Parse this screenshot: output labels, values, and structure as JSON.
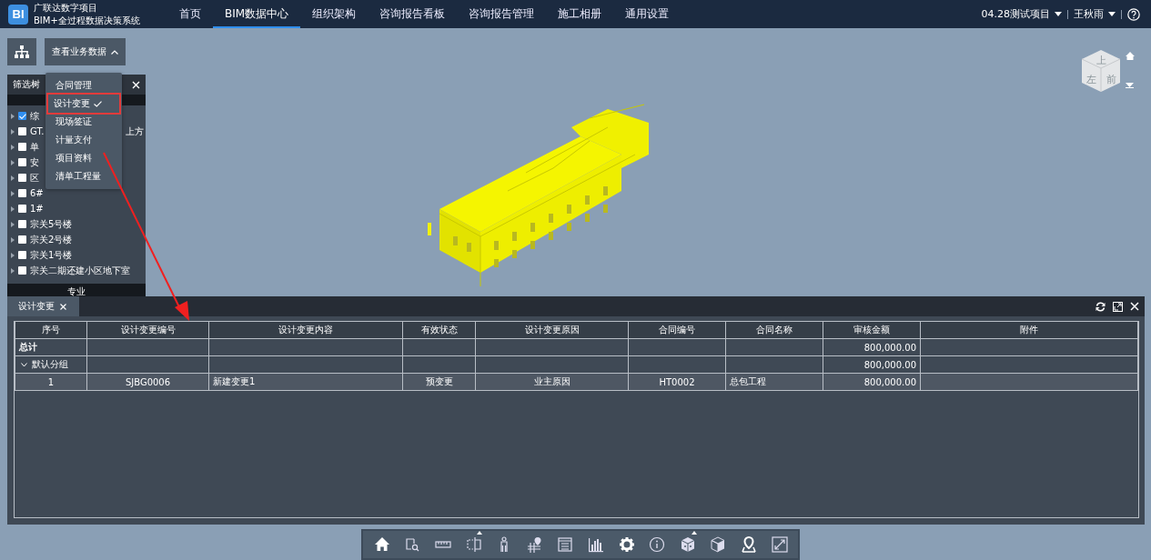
{
  "header": {
    "logo": "BI",
    "title": "广联达数字项目",
    "subtitle": "BIM+全过程数据决策系统",
    "nav": [
      {
        "label": "首页",
        "selected": false
      },
      {
        "label": "BIM数据中心",
        "selected": true
      },
      {
        "label": "组织架构",
        "selected": false
      },
      {
        "label": "咨询报告看板",
        "selected": false
      },
      {
        "label": "咨询报告管理",
        "selected": false
      },
      {
        "label": "施工相册",
        "selected": false
      },
      {
        "label": "通用设置",
        "selected": false
      }
    ],
    "project": "04.28测试项目",
    "user": "王秋雨"
  },
  "viewer": {
    "data_button": {
      "label": "查看业务数据",
      "expanded": true
    },
    "dropdown": [
      {
        "label": "合同管理",
        "selected": false
      },
      {
        "label": "设计变更",
        "selected": true
      },
      {
        "label": "现场签证",
        "selected": false
      },
      {
        "label": "计量支付",
        "selected": false
      },
      {
        "label": "项目资料",
        "selected": false
      },
      {
        "label": "清单工程量",
        "selected": false
      }
    ],
    "filter_panel": {
      "title": "筛选树",
      "section": "专业",
      "tree": [
        {
          "label": "综",
          "checked": true
        },
        {
          "label": "GT.",
          "tail": "上方",
          "checked": false
        },
        {
          "label": "单",
          "checked": false
        },
        {
          "label": "安",
          "checked": false
        },
        {
          "label": "区",
          "checked": false
        },
        {
          "label": "6#",
          "checked": false
        },
        {
          "label": "1#",
          "checked": false
        },
        {
          "label": "宗关5号楼",
          "checked": false
        },
        {
          "label": "宗关2号楼",
          "checked": false
        },
        {
          "label": "宗关1号楼",
          "checked": false
        },
        {
          "label": "宗关二期还建小区地下室",
          "checked": false
        }
      ]
    },
    "nav_cube": {
      "faces": [
        "上",
        "左",
        "前"
      ]
    },
    "panel": {
      "tabs": [
        {
          "label": "设计变更",
          "selected": true
        }
      ],
      "table": {
        "columns": [
          "序号",
          "设计变更编号",
          "设计变更内容",
          "有效状态",
          "设计变更原因",
          "合同编号",
          "合同名称",
          "审核金额",
          "附件"
        ],
        "rows": [
          {
            "kind": "total",
            "cells": [
              "总计",
              null,
              null,
              null,
              null,
              null,
              null,
              "800,000.00",
              null
            ]
          },
          {
            "kind": "group",
            "expanded": true,
            "cells": [
              "默认分组",
              null,
              null,
              null,
              null,
              null,
              null,
              "800,000.00",
              null
            ]
          },
          {
            "kind": "data",
            "cells": [
              "1",
              "SJBG0006",
              "新建变更1",
              "预变更",
              "业主原因",
              "HT0002",
              "总包工程",
              "800,000.00",
              null
            ]
          }
        ]
      }
    },
    "toolbar": [
      {
        "kind": "home",
        "has_menu": false
      },
      {
        "kind": "zoom-box",
        "has_menu": false
      },
      {
        "kind": "ruler",
        "has_menu": false
      },
      {
        "kind": "section",
        "has_menu": true
      },
      {
        "kind": "person",
        "has_menu": false
      },
      {
        "kind": "axis-pin",
        "has_menu": false
      },
      {
        "kind": "list",
        "has_menu": false
      },
      {
        "kind": "chart",
        "has_menu": false
      },
      {
        "kind": "gear",
        "has_menu": false
      },
      {
        "kind": "info",
        "has_menu": false
      },
      {
        "kind": "model",
        "has_menu": true
      },
      {
        "kind": "box",
        "has_menu": false
      },
      {
        "kind": "map-pin",
        "has_menu": false
      },
      {
        "kind": "fullscreen",
        "has_menu": false
      }
    ]
  }
}
